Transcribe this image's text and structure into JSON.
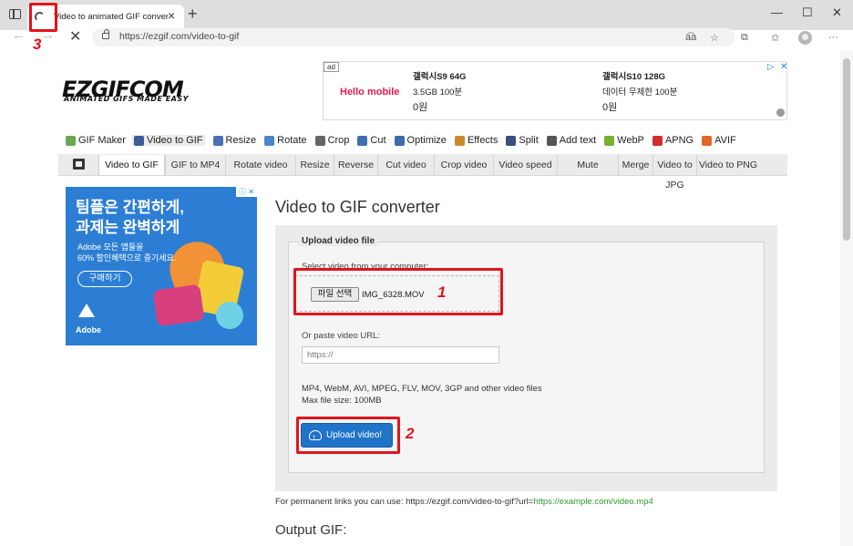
{
  "browser": {
    "tab_title": "Video to animated GIF converter",
    "url": "https://ezgif.com/video-to-gif",
    "window_controls": [
      "—",
      "☐",
      "✕"
    ]
  },
  "header": {
    "logo": "EZGIFCOM",
    "tagline": "ANIMATED GIFS MADE EASY"
  },
  "top_ad": {
    "label": "ad",
    "brand": "Hello mobile",
    "products": [
      {
        "name": "갤럭시S9 64G",
        "detail": "3.5GB 100분",
        "price": "0원"
      },
      {
        "name": "갤럭시S10 128G",
        "detail": "데이터 무제한 100분",
        "price": "0원"
      }
    ]
  },
  "main_menu": [
    {
      "label": "GIF Maker",
      "icon": "gif-maker-icon",
      "color": "#6aa84f"
    },
    {
      "label": "Video to GIF",
      "icon": "video-icon",
      "color": "#3d5a99",
      "active": true
    },
    {
      "label": "Resize",
      "icon": "resize-icon",
      "color": "#4a6fb5"
    },
    {
      "label": "Rotate",
      "icon": "rotate-icon",
      "color": "#4a86c5"
    },
    {
      "label": "Crop",
      "icon": "crop-icon",
      "color": "#666666"
    },
    {
      "label": "Cut",
      "icon": "cut-icon",
      "color": "#3f6fb0"
    },
    {
      "label": "Optimize",
      "icon": "optimize-icon",
      "color": "#3b6db3"
    },
    {
      "label": "Effects",
      "icon": "effects-icon",
      "color": "#c98a2b"
    },
    {
      "label": "Split",
      "icon": "split-icon",
      "color": "#3a4f80"
    },
    {
      "label": "Add text",
      "icon": "add-text-icon",
      "color": "#555555"
    },
    {
      "label": "WebP",
      "icon": "webp-icon",
      "color": "#7ab030"
    },
    {
      "label": "APNG",
      "icon": "apng-icon",
      "color": "#d32d2d"
    },
    {
      "label": "AVIF",
      "icon": "avif-icon",
      "color": "#e0672b"
    }
  ],
  "sub_menu": [
    {
      "label": "Video to GIF",
      "active": true
    },
    {
      "label": "GIF to MP4"
    },
    {
      "label": "Rotate video"
    },
    {
      "label": "Resize"
    },
    {
      "label": "Reverse"
    },
    {
      "label": "Cut video"
    },
    {
      "label": "Crop video"
    },
    {
      "label": "Video speed"
    },
    {
      "label": "Mute"
    },
    {
      "label": "Merge"
    },
    {
      "label": "Video to JPG"
    },
    {
      "label": "Video to PNG"
    }
  ],
  "side_ad": {
    "headline_1": "팀플은 간편하게,",
    "headline_2": "과제는 완벽하게",
    "body_1": "Adobe 모든 앱들을",
    "body_2": "60% 할인혜택으로 즐기세요.",
    "button": "구매하기",
    "brand": "Adobe",
    "adchoices": "ⓘ ✕"
  },
  "main": {
    "title": "Video to GIF converter",
    "legend": "Upload video file",
    "select_label": "Select video from your computer:",
    "file_button": "파일 선택",
    "file_name": "IMG_6328.MOV",
    "url_label": "Or paste video URL:",
    "url_placeholder": "https://",
    "formats_line": "MP4, WebM, AVI, MPEG, FLV, MOV, 3GP and other video files",
    "max_size": "Max file size: 100MB",
    "upload_button": "Upload video!",
    "perm_prefix": "For permanent links you can use: https://ezgif.com/video-to-gif?url=",
    "perm_example": "https://example.com/video.mp4",
    "output_title": "Output GIF:"
  },
  "annotations": [
    "1",
    "2",
    "3"
  ],
  "colors": {
    "annotation": "#e3131b",
    "upload_button": "#1f73c9",
    "side_ad_bg": "#2c7ed4"
  }
}
